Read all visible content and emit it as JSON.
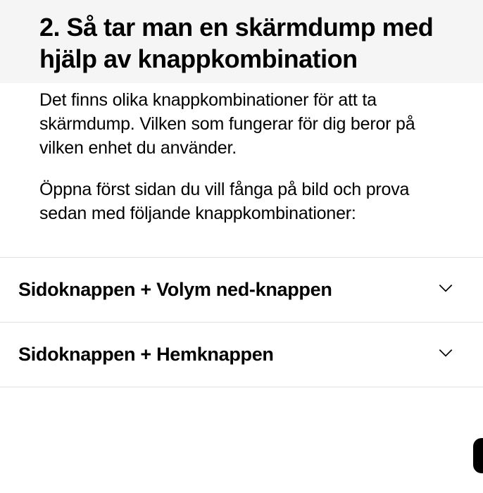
{
  "heading": "2. Så tar man en skärmdump med hjälp av knappkombination",
  "paragraphs": [
    "Det finns olika knappkombinationer för att ta skärmdump. Vilken som fungerar för dig beror på vilken enhet du använder.",
    "Öppna först sidan du vill fånga på bild och prova sedan med följande knappkombinationer:"
  ],
  "accordion": {
    "items": [
      {
        "label": "Sidoknappen + Volym ned-knappen"
      },
      {
        "label": "Sidoknappen + Hemknappen"
      }
    ]
  }
}
